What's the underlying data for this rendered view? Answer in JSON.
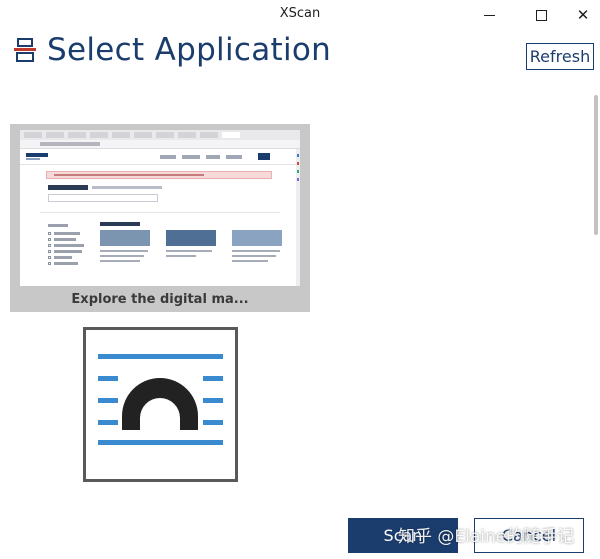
{
  "window": {
    "title": "XScan",
    "minimize_icon": "minimize-icon",
    "maximize_icon": "maximize-icon",
    "close_icon": "close-icon",
    "close_glyph": "✕"
  },
  "header": {
    "title": "Select Application",
    "icon": "scanner-icon",
    "refresh_label": "Refresh"
  },
  "applications": [
    {
      "caption": "Explore the digital ma...",
      "kind": "browser-window-thumbnail"
    },
    {
      "caption": "",
      "kind": "app-icon-thumbnail"
    }
  ],
  "footer": {
    "scan_label": "Scan",
    "cancel_label": "Cancel"
  },
  "watermark": "知乎 @Elaine的随手记",
  "colors": {
    "accent": "#1b3d6e",
    "icon_blue": "#3a8ad0",
    "thumbnail_bg": "#c8c8c8"
  }
}
